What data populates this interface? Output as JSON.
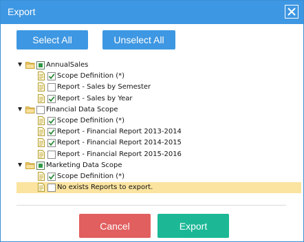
{
  "dialog": {
    "title": "Export",
    "select_all": "Select All",
    "unselect_all": "Unselect All",
    "cancel": "Cancel",
    "export": "Export"
  },
  "tree": [
    {
      "label": "AnnualSales",
      "level": 0,
      "type": "group",
      "checked": "partial",
      "expanded": true
    },
    {
      "label": "Scope Definition (*)",
      "level": 1,
      "type": "item",
      "checked": true
    },
    {
      "label": "Report - Sales by Semester",
      "level": 1,
      "type": "item",
      "checked": false
    },
    {
      "label": "Report - Sales by Year",
      "level": 1,
      "type": "item",
      "checked": true
    },
    {
      "label": "Financial Data Scope",
      "level": 0,
      "type": "group",
      "checked": false,
      "expanded": true
    },
    {
      "label": "Scope Definition (*)",
      "level": 1,
      "type": "item",
      "checked": true
    },
    {
      "label": "Report - Financial Report 2013-2014",
      "level": 1,
      "type": "item",
      "checked": true
    },
    {
      "label": "Report - Financial Report 2014-2015",
      "level": 1,
      "type": "item",
      "checked": true
    },
    {
      "label": "Report - Financial Report 2015-2016",
      "level": 1,
      "type": "item",
      "checked": false
    },
    {
      "label": "Marketing Data Scope",
      "level": 0,
      "type": "group",
      "checked": "partial",
      "expanded": true
    },
    {
      "label": "Scope Definition (*)",
      "level": 1,
      "type": "item",
      "checked": true
    },
    {
      "label": "No exists Reports to export.",
      "level": 1,
      "type": "item",
      "checked": false,
      "highlighted": true
    }
  ],
  "colors": {
    "accent": "#3e97e2",
    "cancel": "#e15f5f",
    "export": "#1cb896",
    "highlight": "#fbe4a0"
  }
}
